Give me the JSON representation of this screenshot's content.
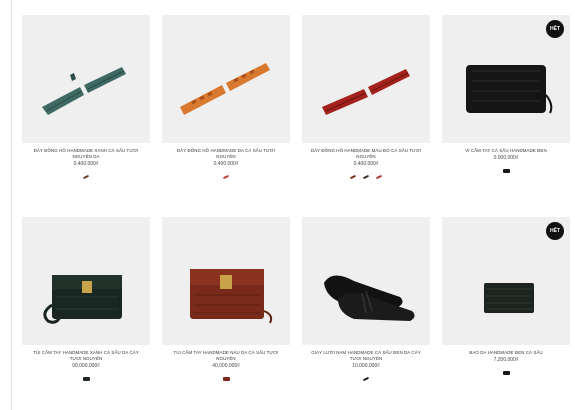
{
  "badge_label": "HẾT",
  "colors": {
    "background": "#ffffff",
    "image_bg": "#efefef",
    "badge": "#111111"
  },
  "products": [
    {
      "name": "DÂY ĐỒNG HỒ HANDMADE XANH CÁ SẤU TƯƠI NGUYÊN DA",
      "price": "0.400.000₫",
      "badge": false,
      "icon": "green-croc-watch-strap-icon",
      "swatches": [
        "#6b3b2a"
      ]
    },
    {
      "name": "DÂY ĐỒNG HỒ HANDMADE DA CÁ SẤU TƯƠI NGUYÊN",
      "price": "0.400.000₫",
      "badge": false,
      "icon": "orange-croc-watch-strap-icon",
      "swatches": [
        "#c23b2e"
      ]
    },
    {
      "name": "DÂY ĐỒNG HỒ HANDMADE MÀU ĐỎ CÁ SẤU TƯƠI NGUYÊN",
      "price": "0.400.000₫",
      "badge": false,
      "icon": "red-croc-watch-strap-icon",
      "swatches": [
        "#7a2a20",
        "#3a2a22",
        "#a8322a"
      ]
    },
    {
      "name": "VÍ CẦM TAY CÁ SẤU HANDMADE ĐEN",
      "price": "0.000.000₫",
      "badge": true,
      "icon": "black-croc-wallet-icon",
      "swatches": [
        "#1a1a1a"
      ]
    },
    {
      "name": "TÚI CẦM TAY HANDMADE XANH CÁ SẤU DA CÂY TƯƠI NGUYÊN",
      "price": "00.000.000₫",
      "badge": false,
      "icon": "green-croc-clutch-icon",
      "swatches": [
        "#1c2a22"
      ]
    },
    {
      "name": "TÚI CẦM TAY HANDMADE NÂU DA CÁ SẤU TƯƠI NGUYÊN",
      "price": "40.000.000₫",
      "badge": false,
      "icon": "brown-croc-clutch-icon",
      "swatches": [
        "#7a2a1e"
      ]
    },
    {
      "name": "GIÀY LƯỜI NAM HANDMADE CÁ SẤU ĐEN DA CÂY TƯƠI NGUYÊN",
      "price": "10.000.000₫",
      "badge": false,
      "icon": "black-croc-loafers-icon",
      "swatches": [
        "#1a1a1a"
      ]
    },
    {
      "name": "BAO DA HANDMADE ĐEN CÁ SẤU",
      "price": "7.200.000₫",
      "badge": true,
      "icon": "black-croc-cardholder-icon",
      "swatches": [
        "#1a1a1a"
      ]
    }
  ]
}
